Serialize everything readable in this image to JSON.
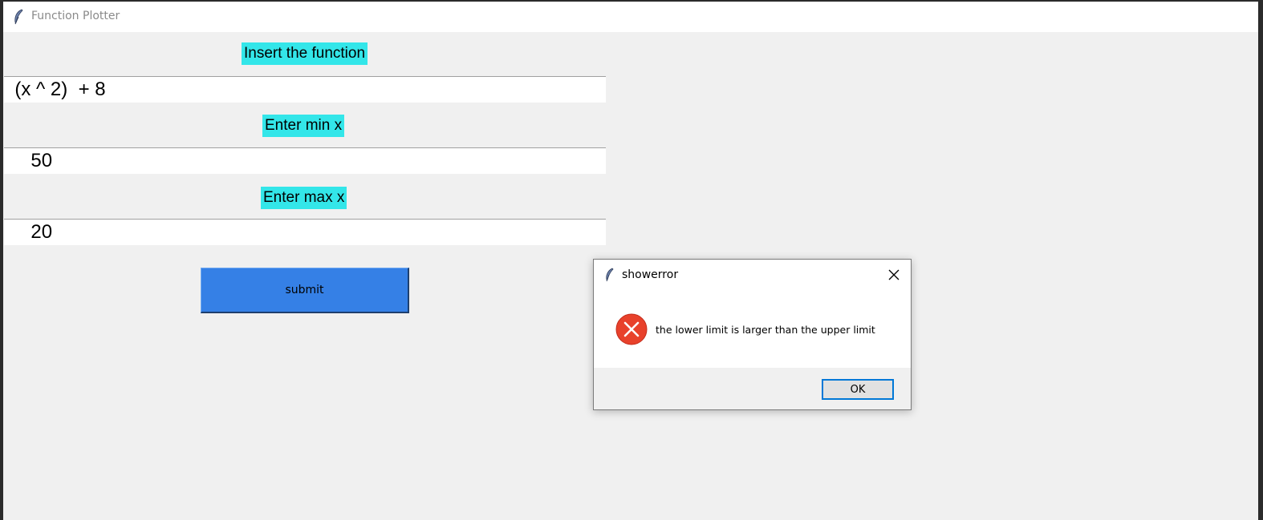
{
  "window": {
    "title": "Function Plotter",
    "icon": "feather-icon"
  },
  "form": {
    "function_label": "Insert the function",
    "function_value": "  (x ^ 2)  + 8",
    "min_label": "Enter min x",
    "min_value": "     50",
    "max_label": "Enter max x",
    "max_value": "     20",
    "submit_label": "submit"
  },
  "dialog": {
    "title": "showerror",
    "icon": "feather-icon",
    "close_icon": "close-icon",
    "error_icon": "error-icon",
    "message": "the lower limit is larger than the upper limit",
    "ok_label": "OK"
  },
  "colors": {
    "label_bg": "#33e6e9",
    "submit_bg": "#3580e6",
    "error_red": "#e8412b",
    "ok_border": "#0078d7"
  }
}
